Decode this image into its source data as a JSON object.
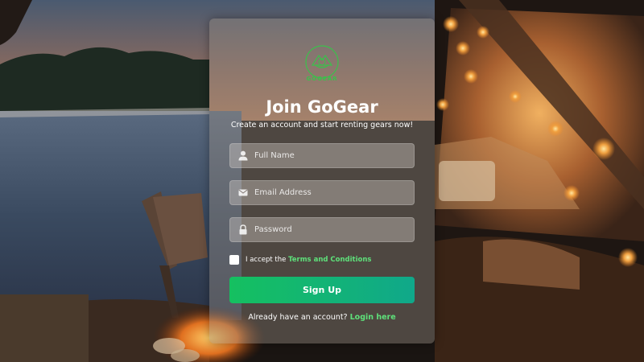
{
  "brand": {
    "name": "GOGEAR",
    "accent_color": "#3cbf4c"
  },
  "form": {
    "title": "Join GoGear",
    "subtitle": "Create an account and start renting gears now!",
    "fields": {
      "full_name": {
        "placeholder": "Full Name",
        "value": "",
        "icon": "user-icon"
      },
      "email": {
        "placeholder": "Email Address",
        "value": "",
        "icon": "envelope-icon"
      },
      "password": {
        "placeholder": "Password",
        "value": "",
        "icon": "lock-icon"
      }
    },
    "terms": {
      "prefix": "I accept the ",
      "link_label": "Terms and Conditions",
      "checked": false
    },
    "submit_label": "Sign Up",
    "login_prompt": "Already have an account?",
    "login_link_label": "Login here",
    "button_gradient": [
      "#15c060",
      "#10a88a"
    ],
    "link_color": "#5ee07a"
  },
  "background": {
    "description_icon": "lake-campsite-background"
  }
}
